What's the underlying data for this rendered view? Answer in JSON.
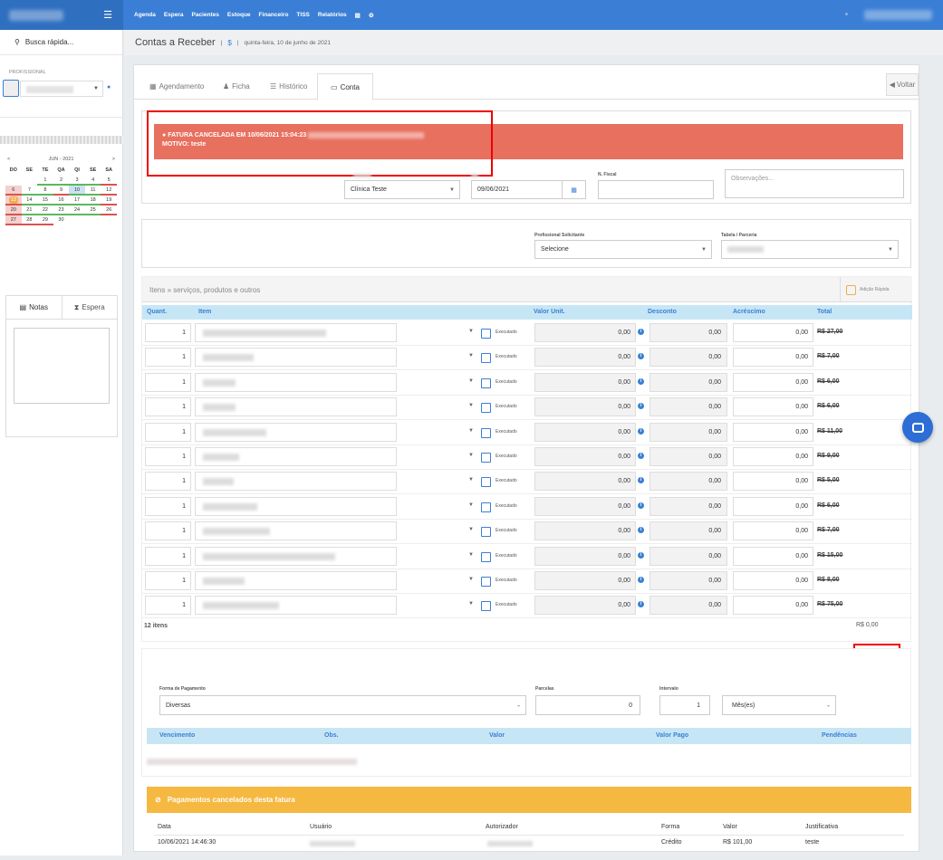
{
  "topnav": [
    "Agenda",
    "Espera",
    "Pacientes",
    "Estoque",
    "Financeiro",
    "TISS",
    "Relatórios"
  ],
  "sidebar": {
    "search": "Busca rápida...",
    "prof_label": "PROFISSIONAL",
    "calendar": {
      "title": "JUN - 2021",
      "prev": "<",
      "next": ">",
      "dow": [
        "DO",
        "SE",
        "TE",
        "QA",
        "QI",
        "SE",
        "SA"
      ],
      "weeks": [
        [
          "",
          "",
          "1",
          "2",
          "3",
          "4",
          "5"
        ],
        [
          "6",
          "7",
          "8",
          "9",
          "10",
          "11",
          "12"
        ],
        [
          "13",
          "14",
          "15",
          "16",
          "17",
          "18",
          "19"
        ],
        [
          "20",
          "21",
          "22",
          "23",
          "24",
          "25",
          "26"
        ],
        [
          "27",
          "28",
          "29",
          "30",
          "",
          "",
          ""
        ]
      ]
    },
    "tabs": [
      "Notas",
      "Espera"
    ]
  },
  "header": {
    "title": "Contas a Receber",
    "dollar": "$",
    "date": "quinta-feira, 10 de junho de 2021"
  },
  "tabs": [
    "Agendamento",
    "Ficha",
    "Histórico",
    "Conta"
  ],
  "voltar": "Voltar",
  "alert": {
    "line1": "FATURA CANCELADA EM 10/06/2021 15:04:23",
    "line2": "MOTIVO: teste"
  },
  "form": {
    "unidade_value": "Clínica Teste",
    "data_value": "09/06/2021",
    "nfiscal_label": "N. Fiscal",
    "obs_placeholder": "Observações...",
    "prof_solic_label": "Profissional Solicitante",
    "prof_solic_value": "Selecione",
    "tabela_label": "Tabela / Parceria"
  },
  "items": {
    "title": "Itens » serviços, produtos e outros",
    "adicao": "Adição Rápida",
    "headers": [
      "Quant.",
      "Item",
      "Valor Unit.",
      "Desconto",
      "Acréscimo",
      "Total"
    ],
    "executado": "Executado",
    "rows": [
      {
        "q": "1",
        "vu": "0,00",
        "de": "0,00",
        "ac": "0,00",
        "tot": "R$ 27,00"
      },
      {
        "q": "1",
        "vu": "0,00",
        "de": "0,00",
        "ac": "0,00",
        "tot": "R$ 7,00"
      },
      {
        "q": "1",
        "vu": "0,00",
        "de": "0,00",
        "ac": "0,00",
        "tot": "R$ 6,00"
      },
      {
        "q": "1",
        "vu": "0,00",
        "de": "0,00",
        "ac": "0,00",
        "tot": "R$ 6,00"
      },
      {
        "q": "1",
        "vu": "0,00",
        "de": "0,00",
        "ac": "0,00",
        "tot": "R$ 11,00"
      },
      {
        "q": "1",
        "vu": "0,00",
        "de": "0,00",
        "ac": "0,00",
        "tot": "R$ 9,00"
      },
      {
        "q": "1",
        "vu": "0,00",
        "de": "0,00",
        "ac": "0,00",
        "tot": "R$ 5,00"
      },
      {
        "q": "1",
        "vu": "0,00",
        "de": "0,00",
        "ac": "0,00",
        "tot": "R$ 6,00"
      },
      {
        "q": "1",
        "vu": "0,00",
        "de": "0,00",
        "ac": "0,00",
        "tot": "R$ 7,00"
      },
      {
        "q": "1",
        "vu": "0,00",
        "de": "0,00",
        "ac": "0,00",
        "tot": "R$ 15,00"
      },
      {
        "q": "1",
        "vu": "0,00",
        "de": "0,00",
        "ac": "0,00",
        "tot": "R$ 8,00"
      },
      {
        "q": "1",
        "vu": "0,00",
        "de": "0,00",
        "ac": "0,00",
        "tot": "R$ 75,00"
      }
    ],
    "count": "12 itens",
    "total": "R$ 0,00"
  },
  "payment": {
    "forma_label": "Forma de Pagamento",
    "forma_value": "Diversas",
    "parcelas_label": "Parcelas",
    "parcelas_value": "0",
    "intervalo_label": "Intervalo",
    "intervalo_value": "1",
    "periodo_value": "Mês(es)",
    "headers": [
      "Vencimento",
      "Obs.",
      "Valor",
      "Valor Pago",
      "Pendências"
    ]
  },
  "cancelled": {
    "title": "Pagamentos cancelados desta fatura",
    "headers": [
      "Data",
      "Usuário",
      "Autorizador",
      "Forma",
      "Valor",
      "Justificativa"
    ],
    "row": {
      "data": "10/06/2021 14:46:30",
      "forma": "Crédito",
      "valor": "R$ 101,00",
      "just": "teste"
    }
  }
}
